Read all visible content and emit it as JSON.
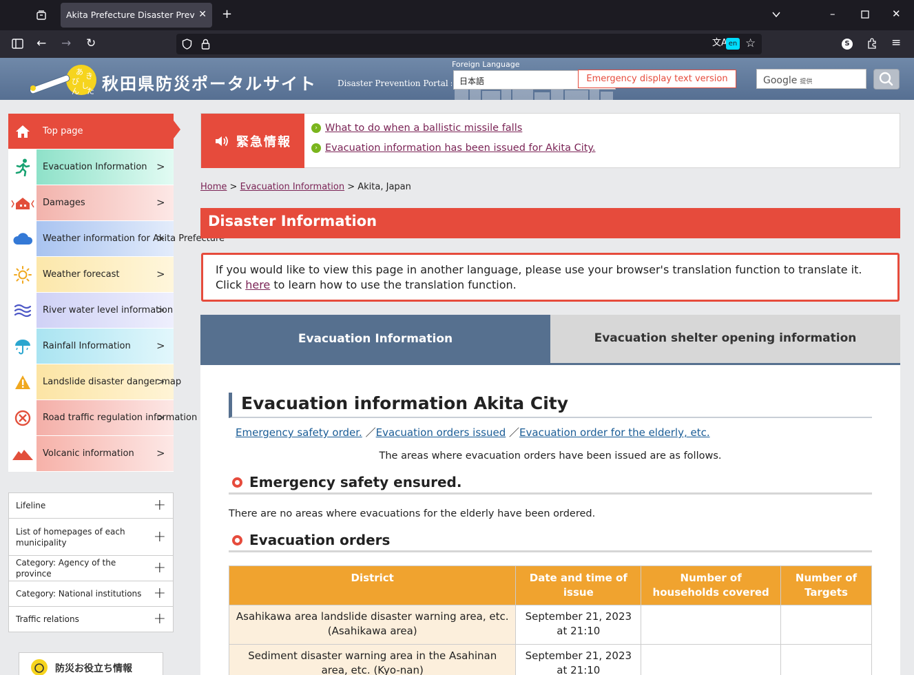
{
  "browser": {
    "tab_title": "Akita Prefecture Disaster Prevention",
    "translate_badge": "en",
    "profile_initial": "S"
  },
  "header": {
    "site_title": "秋田県防災ポータルサイト",
    "site_subtitle": "Disaster Prevention Portal site",
    "foreign_language_label": "Foreign Language",
    "language_selected": "日本語",
    "emergency_text_button": "Emergency display text version",
    "google_label": "Google",
    "google_provided": "提供"
  },
  "sidebar": {
    "menu": [
      {
        "label": "Top page",
        "icon": "home-icon"
      },
      {
        "label": "Evacuation Information",
        "icon": "running-person-icon"
      },
      {
        "label": "Damages",
        "icon": "collapsed-house-icon"
      },
      {
        "label": "Weather information for Akita Prefecture",
        "icon": "cloud-icon"
      },
      {
        "label": "Weather forecast",
        "icon": "sun-icon"
      },
      {
        "label": "River water level information",
        "icon": "waves-icon"
      },
      {
        "label": "Rainfall Information",
        "icon": "umbrella-icon"
      },
      {
        "label": "Landslide disaster danger map",
        "icon": "warning-icon"
      },
      {
        "label": "Road traffic regulation information",
        "icon": "no-entry-icon"
      },
      {
        "label": "Volcanic information",
        "icon": "volcano-icon"
      }
    ],
    "links": [
      {
        "label": "Lifeline"
      },
      {
        "label": "List of homepages of each municipality"
      },
      {
        "label": "Category: Agency of the province"
      },
      {
        "label": "Category: National institutions"
      },
      {
        "label": "Traffic relations"
      }
    ],
    "banner_text": "防災お役立ち情報"
  },
  "emergency": {
    "heading": "緊急情報",
    "links": [
      "What to do when a ballistic missile falls",
      "Evacuation information has been issued for Akita City."
    ]
  },
  "breadcrumb": {
    "home": "Home",
    "evac": "Evacuation Information",
    "current": "Akita, Japan"
  },
  "main": {
    "section_title": "Disaster Information",
    "notice_line1": "If you would like to view this page in another language, please use your browser's translation function to translate it.",
    "notice_click": "Click",
    "notice_here": "here",
    "notice_rest": "to learn how to use the translation function.",
    "tabs": [
      {
        "label": "Evacuation Information"
      },
      {
        "label": "Evacuation shelter opening information"
      }
    ],
    "evac_heading": "Evacuation information Akita City",
    "anchor_links": [
      "Emergency safety order.",
      "Evacuation orders issued",
      "Evacuation order for the elderly, etc."
    ],
    "areas_text": "The areas where evacuation orders have been issued are as follows.",
    "emergency_safety_heading": "Emergency safety ensured.",
    "no_elderly_text": "There are no areas where evacuations for the elderly have been ordered.",
    "evac_orders_heading": "Evacuation orders",
    "table": {
      "headers": [
        "District",
        "Date and time of issue",
        "Number of households covered",
        "Number of Targets"
      ],
      "rows": [
        [
          "Asahikawa area landslide disaster warning area, etc. (Asahikawa area)",
          "September 21, 2023 at 21:10",
          "",
          ""
        ],
        [
          "Sediment disaster warning area in the Asahinan area, etc. (Kyo-nan)",
          "September 21, 2023 at 21:10",
          "",
          ""
        ]
      ]
    }
  },
  "colors": {
    "accent_red": "#e64b3c",
    "tab_blue": "#56708f",
    "table_orange": "#f0a32f",
    "link_purple": "#7a2355"
  }
}
